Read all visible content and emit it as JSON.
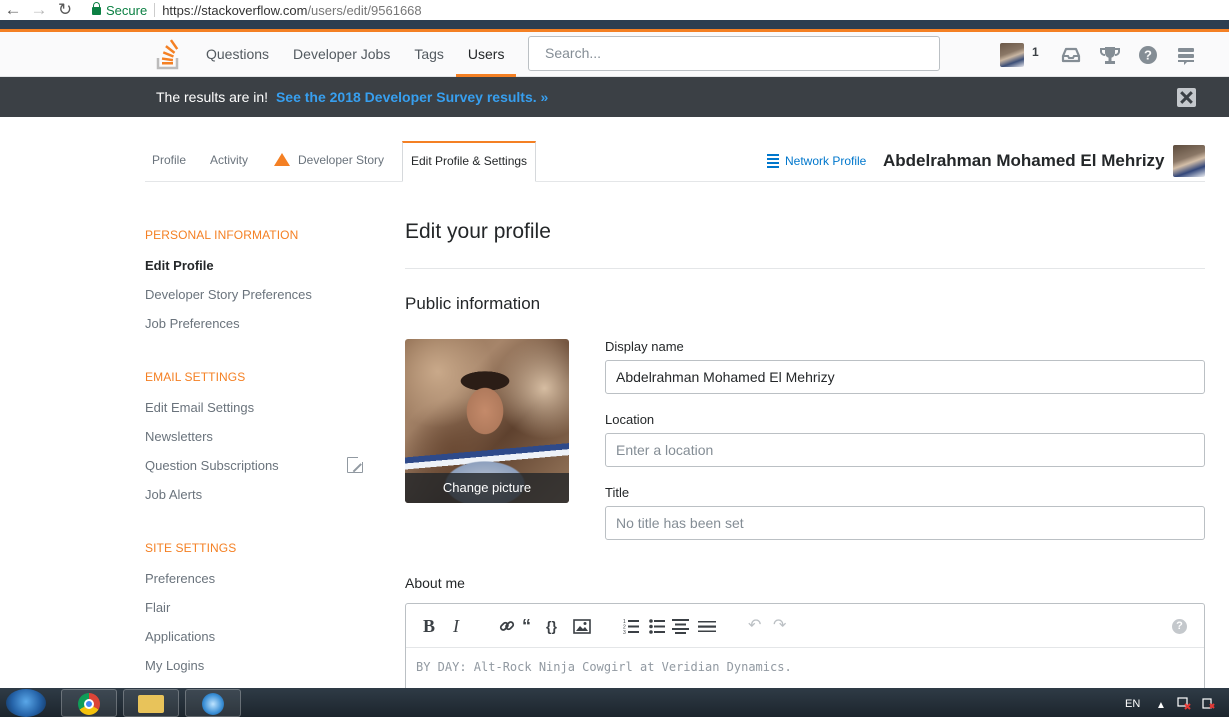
{
  "browser": {
    "secure_label": "Secure",
    "url_host": "https://stackoverflow.com",
    "url_path": "/users/edit/9561668"
  },
  "topbar": {
    "nav": [
      "Questions",
      "Developer Jobs",
      "Tags",
      "Users"
    ],
    "active_nav": "Users",
    "search_placeholder": "Search...",
    "reputation": "1"
  },
  "banner": {
    "text": "The results are in!",
    "link": "See the 2018 Developer Survey results. »"
  },
  "profile_tabs": {
    "tabs": [
      "Profile",
      "Activity",
      "Developer Story",
      "Edit Profile & Settings"
    ],
    "network_profile": "Network Profile",
    "user_name": "Abdelrahman Mohamed El Mehrizy"
  },
  "sidebar": {
    "personal_heading": "PERSONAL INFORMATION",
    "personal_items": [
      "Edit Profile",
      "Developer Story Preferences",
      "Job Preferences"
    ],
    "email_heading": "EMAIL SETTINGS",
    "email_items": [
      "Edit Email Settings",
      "Newsletters",
      "Question Subscriptions",
      "Job Alerts"
    ],
    "site_heading": "SITE SETTINGS",
    "site_items": [
      "Preferences",
      "Flair",
      "Applications",
      "My Logins"
    ]
  },
  "main": {
    "title": "Edit your profile",
    "section_title": "Public information",
    "change_picture": "Change picture",
    "display_name_label": "Display name",
    "display_name_value": "Abdelrahman Mohamed El Mehrizy",
    "location_label": "Location",
    "location_placeholder": "Enter a location",
    "title_label": "Title",
    "title_placeholder": "No title has been set",
    "about_label": "About me",
    "about_placeholder": "BY DAY: Alt-Rock Ninja Cowgirl at Veridian Dynamics."
  },
  "taskbar": {
    "language": "EN"
  },
  "colors": {
    "accent": "#f48024",
    "link": "#0077cc",
    "banner_bg": "#3b4045",
    "banner_link": "#379fef"
  }
}
